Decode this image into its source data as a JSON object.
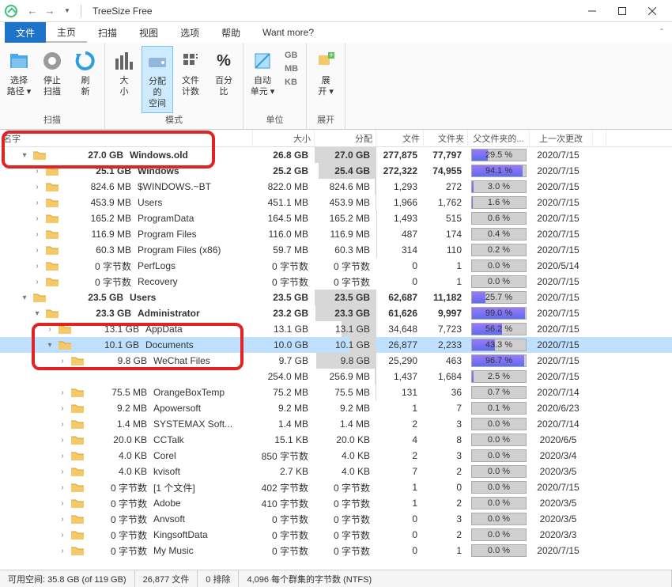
{
  "title": "TreeSize Free",
  "tabs": {
    "file": "文件",
    "home": "主页",
    "scan": "扫描",
    "view": "视图",
    "options": "选项",
    "help": "帮助",
    "more": "Want more?"
  },
  "ribbon": {
    "g1": {
      "label": "扫描",
      "select_path": "选择\n路径 ▾",
      "stop_scan": "停止\n扫描",
      "refresh": "刷\n新"
    },
    "g2": {
      "label": "模式",
      "size": "大\n小",
      "allocated": "分配的\n空间",
      "file_count": "文件\n计数",
      "percent": "百分\n比"
    },
    "g3": {
      "label": "单位",
      "auto_unit": "自动\n单元 ▾",
      "gb": "GB",
      "mb": "MB",
      "kb": "KB"
    },
    "g4": {
      "label": "展开",
      "expand": "展\n开 ▾"
    }
  },
  "cols": {
    "name": "名字",
    "size": "大小",
    "alloc": "分配",
    "files": "文件",
    "folders": "文件夹",
    "pct": "父文件夹的...",
    "date": "上一次更改"
  },
  "rows": [
    {
      "indent": 1,
      "chev": "v",
      "sz_label": "27.0 GB",
      "name": "Windows.old",
      "size": "26.8 GB",
      "alloc": "27.0 GB",
      "afill": 100,
      "files": "277,875",
      "folders": "77,797",
      "pct": "29.5 %",
      "pfill": 29.5,
      "date": "2020/7/15",
      "bold": true
    },
    {
      "indent": 2,
      "chev": ">",
      "sz_label": "25.1 GB",
      "name": "Windows",
      "size": "25.2 GB",
      "alloc": "25.4 GB",
      "afill": 94,
      "files": "272,322",
      "folders": "74,955",
      "pct": "94.1 %",
      "pfill": 94.1,
      "date": "2020/7/15",
      "bold": true
    },
    {
      "indent": 2,
      "chev": ">",
      "sz_label": "824.6 MB",
      "name": "$WINDOWS.~BT",
      "size": "822.0 MB",
      "alloc": "824.6 MB",
      "afill": 3,
      "files": "1,293",
      "folders": "272",
      "pct": "3.0 %",
      "pfill": 3.0,
      "date": "2020/7/15"
    },
    {
      "indent": 2,
      "chev": ">",
      "sz_label": "453.9 MB",
      "name": "Users",
      "size": "451.1 MB",
      "alloc": "453.9 MB",
      "afill": 1.6,
      "files": "1,966",
      "folders": "1,762",
      "pct": "1.6 %",
      "pfill": 1.6,
      "date": "2020/7/15"
    },
    {
      "indent": 2,
      "chev": ">",
      "sz_label": "165.2 MB",
      "name": "ProgramData",
      "size": "164.5 MB",
      "alloc": "165.2 MB",
      "afill": 0.6,
      "files": "1,493",
      "folders": "515",
      "pct": "0.6 %",
      "pfill": 0.6,
      "date": "2020/7/15"
    },
    {
      "indent": 2,
      "chev": ">",
      "sz_label": "116.9 MB",
      "name": "Program Files",
      "size": "116.0 MB",
      "alloc": "116.9 MB",
      "afill": 0.4,
      "files": "487",
      "folders": "174",
      "pct": "0.4 %",
      "pfill": 0.4,
      "date": "2020/7/15"
    },
    {
      "indent": 2,
      "chev": ">",
      "sz_label": "60.3 MB",
      "name": "Program Files (x86)",
      "size": "59.7 MB",
      "alloc": "60.3 MB",
      "afill": 0.2,
      "files": "314",
      "folders": "110",
      "pct": "0.2 %",
      "pfill": 0.2,
      "date": "2020/7/15"
    },
    {
      "indent": 2,
      "chev": ">",
      "sz_label": "0 字节数",
      "name": "PerfLogs",
      "size": "0 字节数",
      "alloc": "0 字节数",
      "afill": 0,
      "files": "0",
      "folders": "1",
      "pct": "0.0 %",
      "pfill": 0,
      "date": "2020/5/14"
    },
    {
      "indent": 2,
      "chev": ">",
      "sz_label": "0 字节数",
      "name": "Recovery",
      "size": "0 字节数",
      "alloc": "0 字节数",
      "afill": 0,
      "files": "0",
      "folders": "1",
      "pct": "0.0 %",
      "pfill": 0,
      "date": "2020/7/15"
    },
    {
      "indent": 1,
      "chev": "v",
      "sz_label": "23.5 GB",
      "name": "Users",
      "size": "23.5 GB",
      "alloc": "23.5 GB",
      "afill": 100,
      "files": "62,687",
      "folders": "11,182",
      "pct": "25.7 %",
      "pfill": 25.7,
      "date": "2020/7/15",
      "bold": true
    },
    {
      "indent": 2,
      "chev": "v",
      "sz_label": "23.3 GB",
      "name": "Administrator",
      "size": "23.2 GB",
      "alloc": "23.3 GB",
      "afill": 99,
      "files": "61,626",
      "folders": "9,997",
      "pct": "99.0 %",
      "pfill": 99,
      "date": "2020/7/15",
      "bold": true
    },
    {
      "indent": 3,
      "chev": ">",
      "sz_label": "13.1 GB",
      "name": "AppData",
      "size": "13.1 GB",
      "alloc": "13.1 GB",
      "afill": 56,
      "files": "34,648",
      "folders": "7,723",
      "pct": "56.2 %",
      "pfill": 56.2,
      "date": "2020/7/15"
    },
    {
      "indent": 3,
      "chev": "v",
      "sz_label": "10.1 GB",
      "name": "Documents",
      "size": "10.0 GB",
      "alloc": "10.1 GB",
      "afill": 43,
      "files": "26,877",
      "folders": "2,233",
      "pct": "43.3 %",
      "pfill": 43.3,
      "date": "2020/7/15",
      "sel": true
    },
    {
      "indent": 4,
      "chev": ">",
      "sz_label": "9.8 GB",
      "name": "WeChat Files",
      "size": "9.7 GB",
      "alloc": "9.8 GB",
      "afill": 97,
      "files": "25,290",
      "folders": "463",
      "pct": "96.7 %",
      "pfill": 96.7,
      "date": "2020/7/15"
    },
    {
      "indent": 4,
      "chev": ">",
      "hide_chev": true,
      "sz_label": "",
      "name": "",
      "size": "254.0 MB",
      "alloc": "256.9 MB",
      "afill": 2.5,
      "files": "1,437",
      "folders": "1,684",
      "pct": "2.5 %",
      "pfill": 2.5,
      "date": "2020/7/15"
    },
    {
      "indent": 4,
      "chev": ">",
      "sz_label": "75.5 MB",
      "name": "OrangeBoxTemp",
      "size": "75.2 MB",
      "alloc": "75.5 MB",
      "afill": 0.7,
      "files": "131",
      "folders": "36",
      "pct": "0.7 %",
      "pfill": 0.7,
      "date": "2020/7/14"
    },
    {
      "indent": 4,
      "chev": ">",
      "sz_label": "9.2 MB",
      "name": "Apowersoft",
      "size": "9.2 MB",
      "alloc": "9.2 MB",
      "afill": 0.1,
      "files": "1",
      "folders": "7",
      "pct": "0.1 %",
      "pfill": 0.1,
      "date": "2020/6/23"
    },
    {
      "indent": 4,
      "chev": ">",
      "sz_label": "1.4 MB",
      "name": "SYSTEMAX Soft...",
      "size": "1.4 MB",
      "alloc": "1.4 MB",
      "afill": 0,
      "files": "2",
      "folders": "3",
      "pct": "0.0 %",
      "pfill": 0,
      "date": "2020/7/14"
    },
    {
      "indent": 4,
      "chev": ">",
      "sz_label": "20.0 KB",
      "name": "CCTalk",
      "size": "15.1 KB",
      "alloc": "20.0 KB",
      "afill": 0,
      "files": "4",
      "folders": "8",
      "pct": "0.0 %",
      "pfill": 0,
      "date": "2020/6/5"
    },
    {
      "indent": 4,
      "chev": ">",
      "sz_label": "4.0 KB",
      "name": "Corel",
      "size": "850 字节数",
      "alloc": "4.0 KB",
      "afill": 0,
      "files": "2",
      "folders": "3",
      "pct": "0.0 %",
      "pfill": 0,
      "date": "2020/3/4"
    },
    {
      "indent": 4,
      "chev": ">",
      "sz_label": "4.0 KB",
      "name": "kvisoft",
      "size": "2.7 KB",
      "alloc": "4.0 KB",
      "afill": 0,
      "files": "7",
      "folders": "2",
      "pct": "0.0 %",
      "pfill": 0,
      "date": "2020/3/5"
    },
    {
      "indent": 4,
      "chev": ">",
      "sz_label": "0 字节数",
      "name": "[1 个文件]",
      "size": "402 字节数",
      "alloc": "0 字节数",
      "afill": 0,
      "files": "1",
      "folders": "0",
      "pct": "0.0 %",
      "pfill": 0,
      "date": "2020/7/15"
    },
    {
      "indent": 4,
      "chev": ">",
      "sz_label": "0 字节数",
      "name": "Adobe",
      "size": "410 字节数",
      "alloc": "0 字节数",
      "afill": 0,
      "files": "1",
      "folders": "2",
      "pct": "0.0 %",
      "pfill": 0,
      "date": "2020/3/5"
    },
    {
      "indent": 4,
      "chev": ">",
      "sz_label": "0 字节数",
      "name": "Anvsoft",
      "size": "0 字节数",
      "alloc": "0 字节数",
      "afill": 0,
      "files": "0",
      "folders": "3",
      "pct": "0.0 %",
      "pfill": 0,
      "date": "2020/3/5"
    },
    {
      "indent": 4,
      "chev": ">",
      "sz_label": "0 字节数",
      "name": "KingsoftData",
      "size": "0 字节数",
      "alloc": "0 字节数",
      "afill": 0,
      "files": "0",
      "folders": "2",
      "pct": "0.0 %",
      "pfill": 0,
      "date": "2020/3/3"
    },
    {
      "indent": 4,
      "chev": ">",
      "sz_label": "0 字节数",
      "name": "My Music",
      "size": "0 字节数",
      "alloc": "0 字节数",
      "afill": 0,
      "files": "0",
      "folders": "1",
      "pct": "0.0 %",
      "pfill": 0,
      "date": "2020/7/15"
    }
  ],
  "status": {
    "free": "可用空间: 35.8 GB  (of 119 GB)",
    "files": "26,877 文件",
    "excluded": "0 排除",
    "cluster": "4,096 每个群集的字节数 (NTFS)"
  }
}
